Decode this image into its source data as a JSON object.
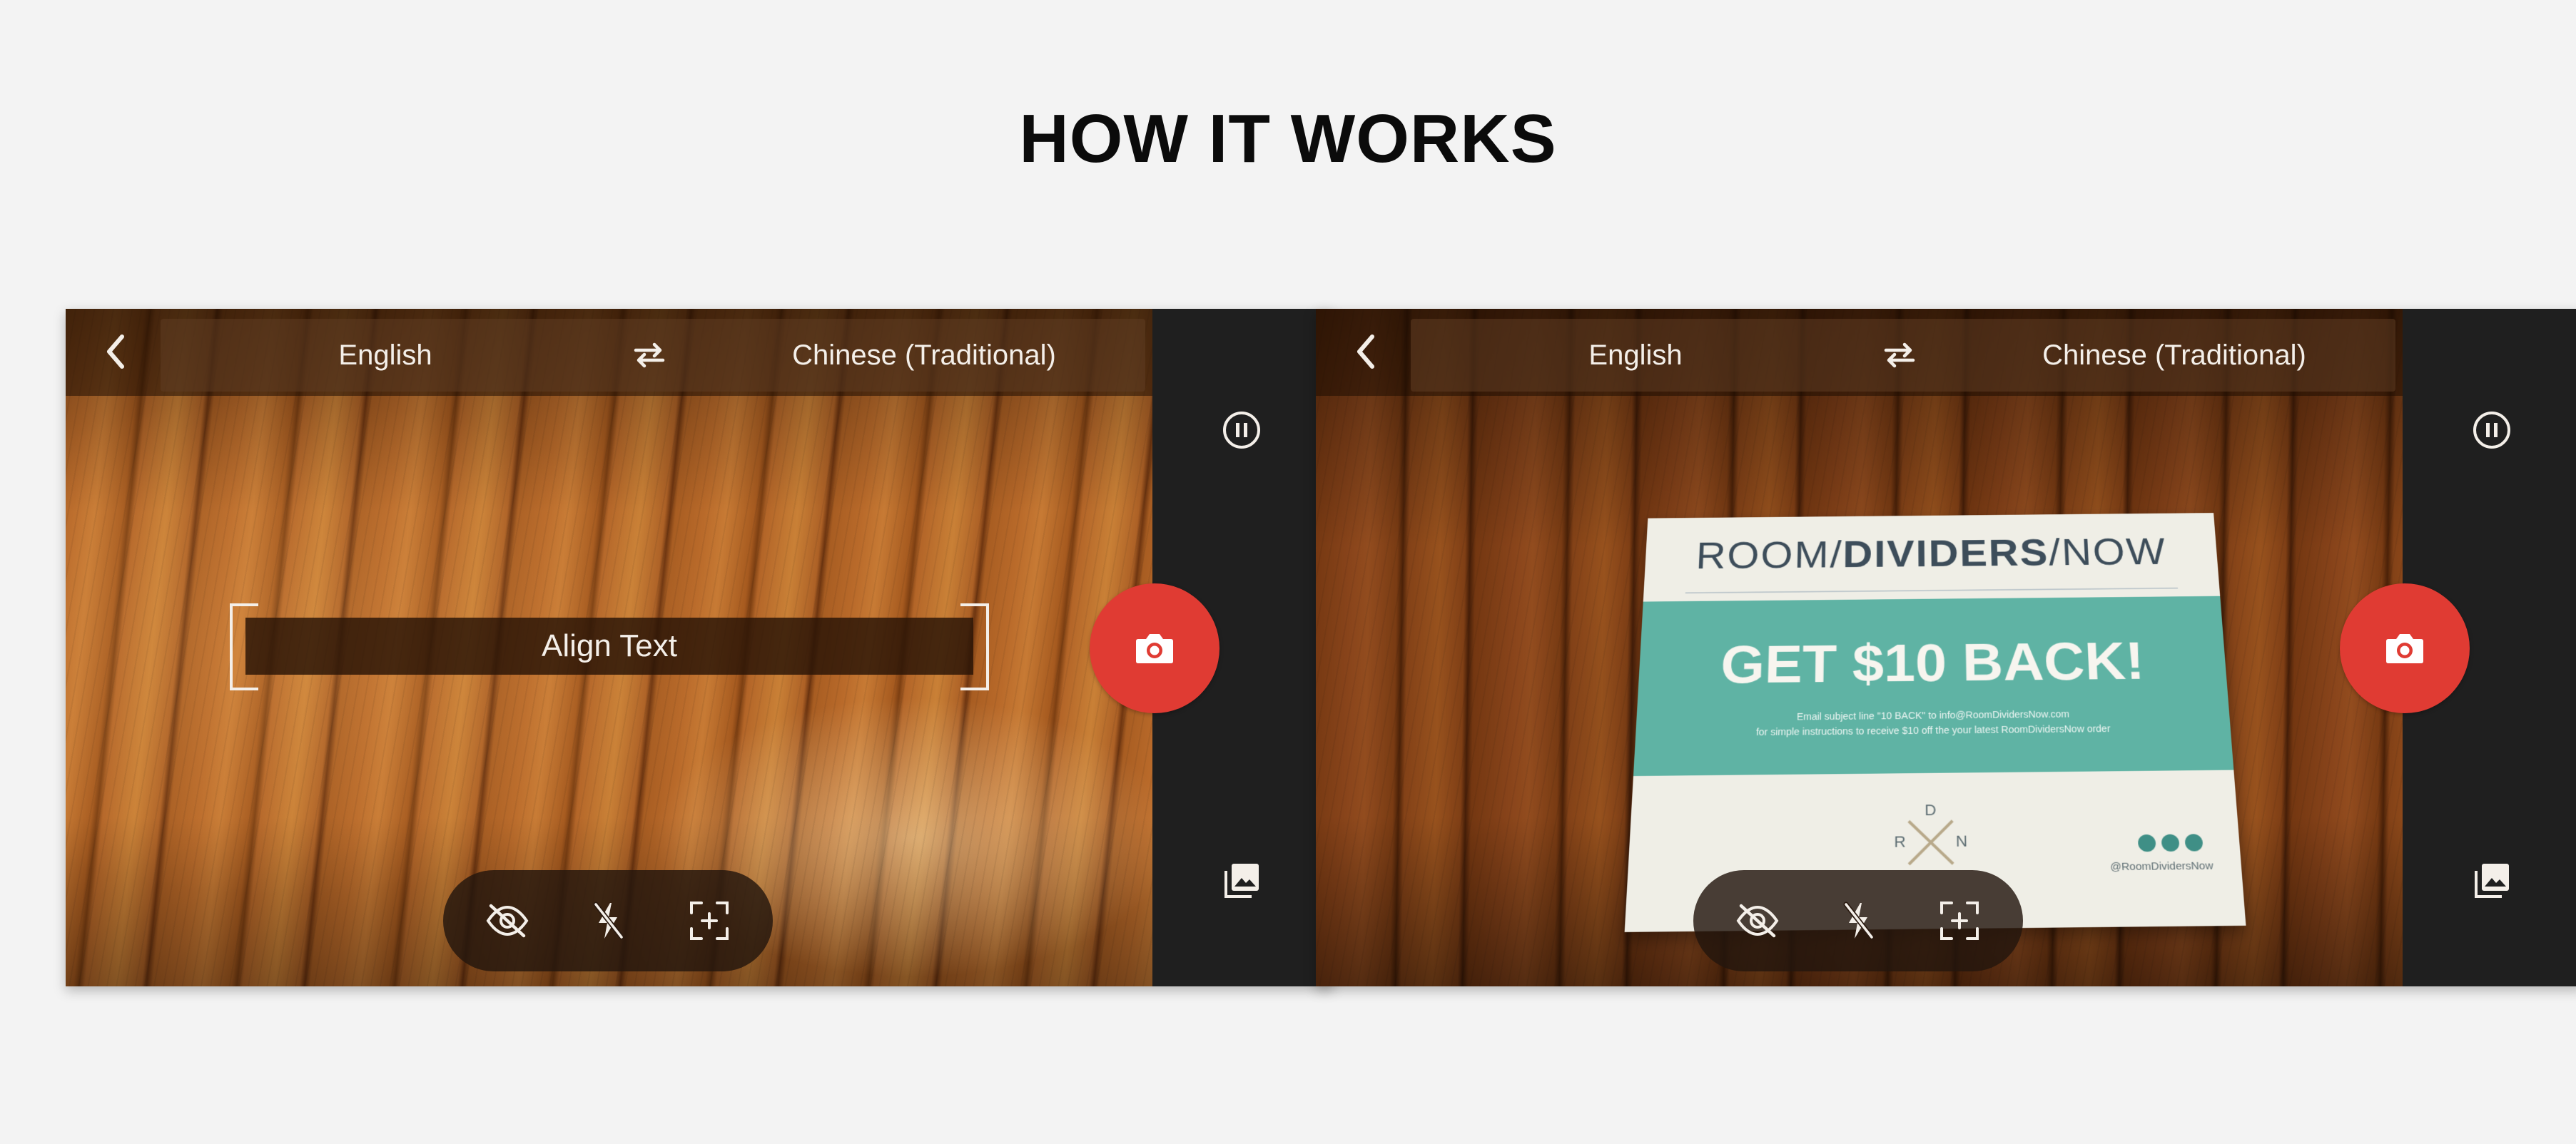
{
  "page": {
    "title": "HOW IT WORKS"
  },
  "screens": [
    {
      "top_bar": {
        "source_language": "English",
        "target_language": "Chinese (Traditional)"
      },
      "align_overlay": {
        "label": "Align Text"
      },
      "colors": {
        "shutter": "#e03b33",
        "sidebar": "#1f1f1f"
      }
    },
    {
      "top_bar": {
        "source_language": "English",
        "target_language": "Chinese (Traditional)"
      },
      "scene_flyer": {
        "logo_left": "ROOM",
        "logo_mid": "DIVIDERS",
        "logo_right": "NOW",
        "headline": "GET $10 BACK!",
        "fine_line_1": "Email subject line \"10 BACK\" to info@RoomDividersNow.com",
        "fine_line_2": "for simple instructions to receive $10 off the your latest RoomDividersNow order",
        "handle": "@RoomDividersNow",
        "monogram": {
          "top": "D",
          "left": "R",
          "right": "N"
        }
      },
      "colors": {
        "shutter": "#e03b33",
        "sidebar": "#1f1f1f",
        "flyer_band": "#5fb3a4"
      }
    }
  ],
  "icons": {
    "back": "chevron-left-icon",
    "swap": "swap-arrows-icon",
    "pause": "pause-circle-icon",
    "shutter": "camera-icon",
    "gallery": "photo-library-icon",
    "hide_overlay": "eye-off-icon",
    "flash_off": "flash-off-icon",
    "focus": "focus-plus-icon"
  }
}
